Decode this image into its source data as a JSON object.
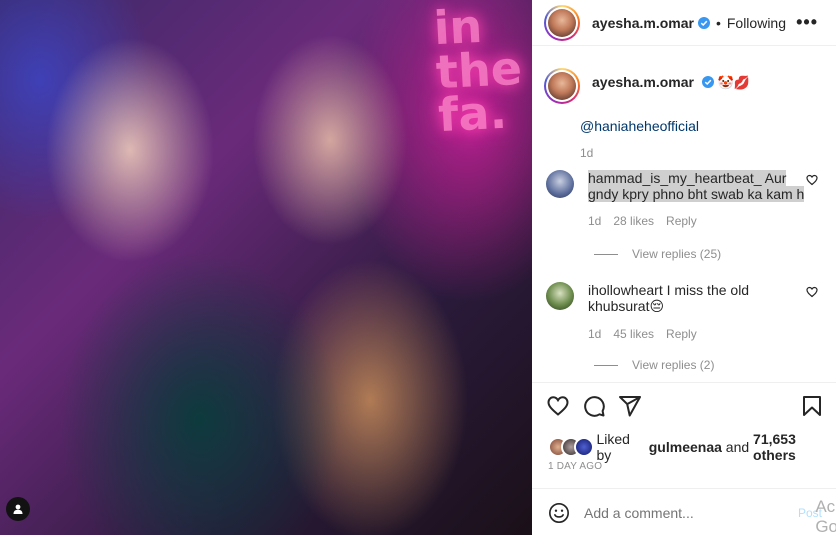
{
  "photo": {
    "neon_text": [
      "in",
      "the",
      "fa."
    ]
  },
  "post": {
    "author": "ayesha.m.omar",
    "follow_status": "Following",
    "dot": "•",
    "more": "•••"
  },
  "caption": {
    "author": "ayesha.m.omar",
    "emojis": "🤡💋",
    "mention": "@haniaheheofficial",
    "age": "1d"
  },
  "comments": [
    {
      "user": "hammad_is_my_heartbeat_",
      "text": "Aur gndy kpry phno bht swab ka kam h",
      "age": "1d",
      "likes": "28 likes",
      "reply": "Reply",
      "view_replies": "View replies (25)"
    },
    {
      "user": "ihollowheart",
      "text": "I miss the old khubsurat",
      "emoji": "😔",
      "age": "1d",
      "likes": "45 likes",
      "reply": "Reply",
      "view_replies": "View replies (2)"
    }
  ],
  "likes": {
    "prefix": "Liked by",
    "user": "gulmeenaa",
    "and": "and",
    "others": "71,653 others"
  },
  "timestamp": "1 DAY AGO",
  "add_comment": {
    "placeholder": "Add a comment...",
    "post_label": "Post"
  },
  "watermark": [
    "Ac",
    "Go"
  ],
  "icons": {
    "verified": "verified-badge-icon",
    "more": "more-options-icon",
    "like": "heart-icon",
    "comment": "comment-icon",
    "share": "share-icon",
    "save": "bookmark-icon",
    "emoji": "emoji-icon",
    "tag": "user-tag-icon"
  },
  "colors": {
    "verified_blue": "#3897f0",
    "link": "#00376b",
    "muted": "#8e8e8e",
    "post_disabled": "#b2dffc"
  }
}
